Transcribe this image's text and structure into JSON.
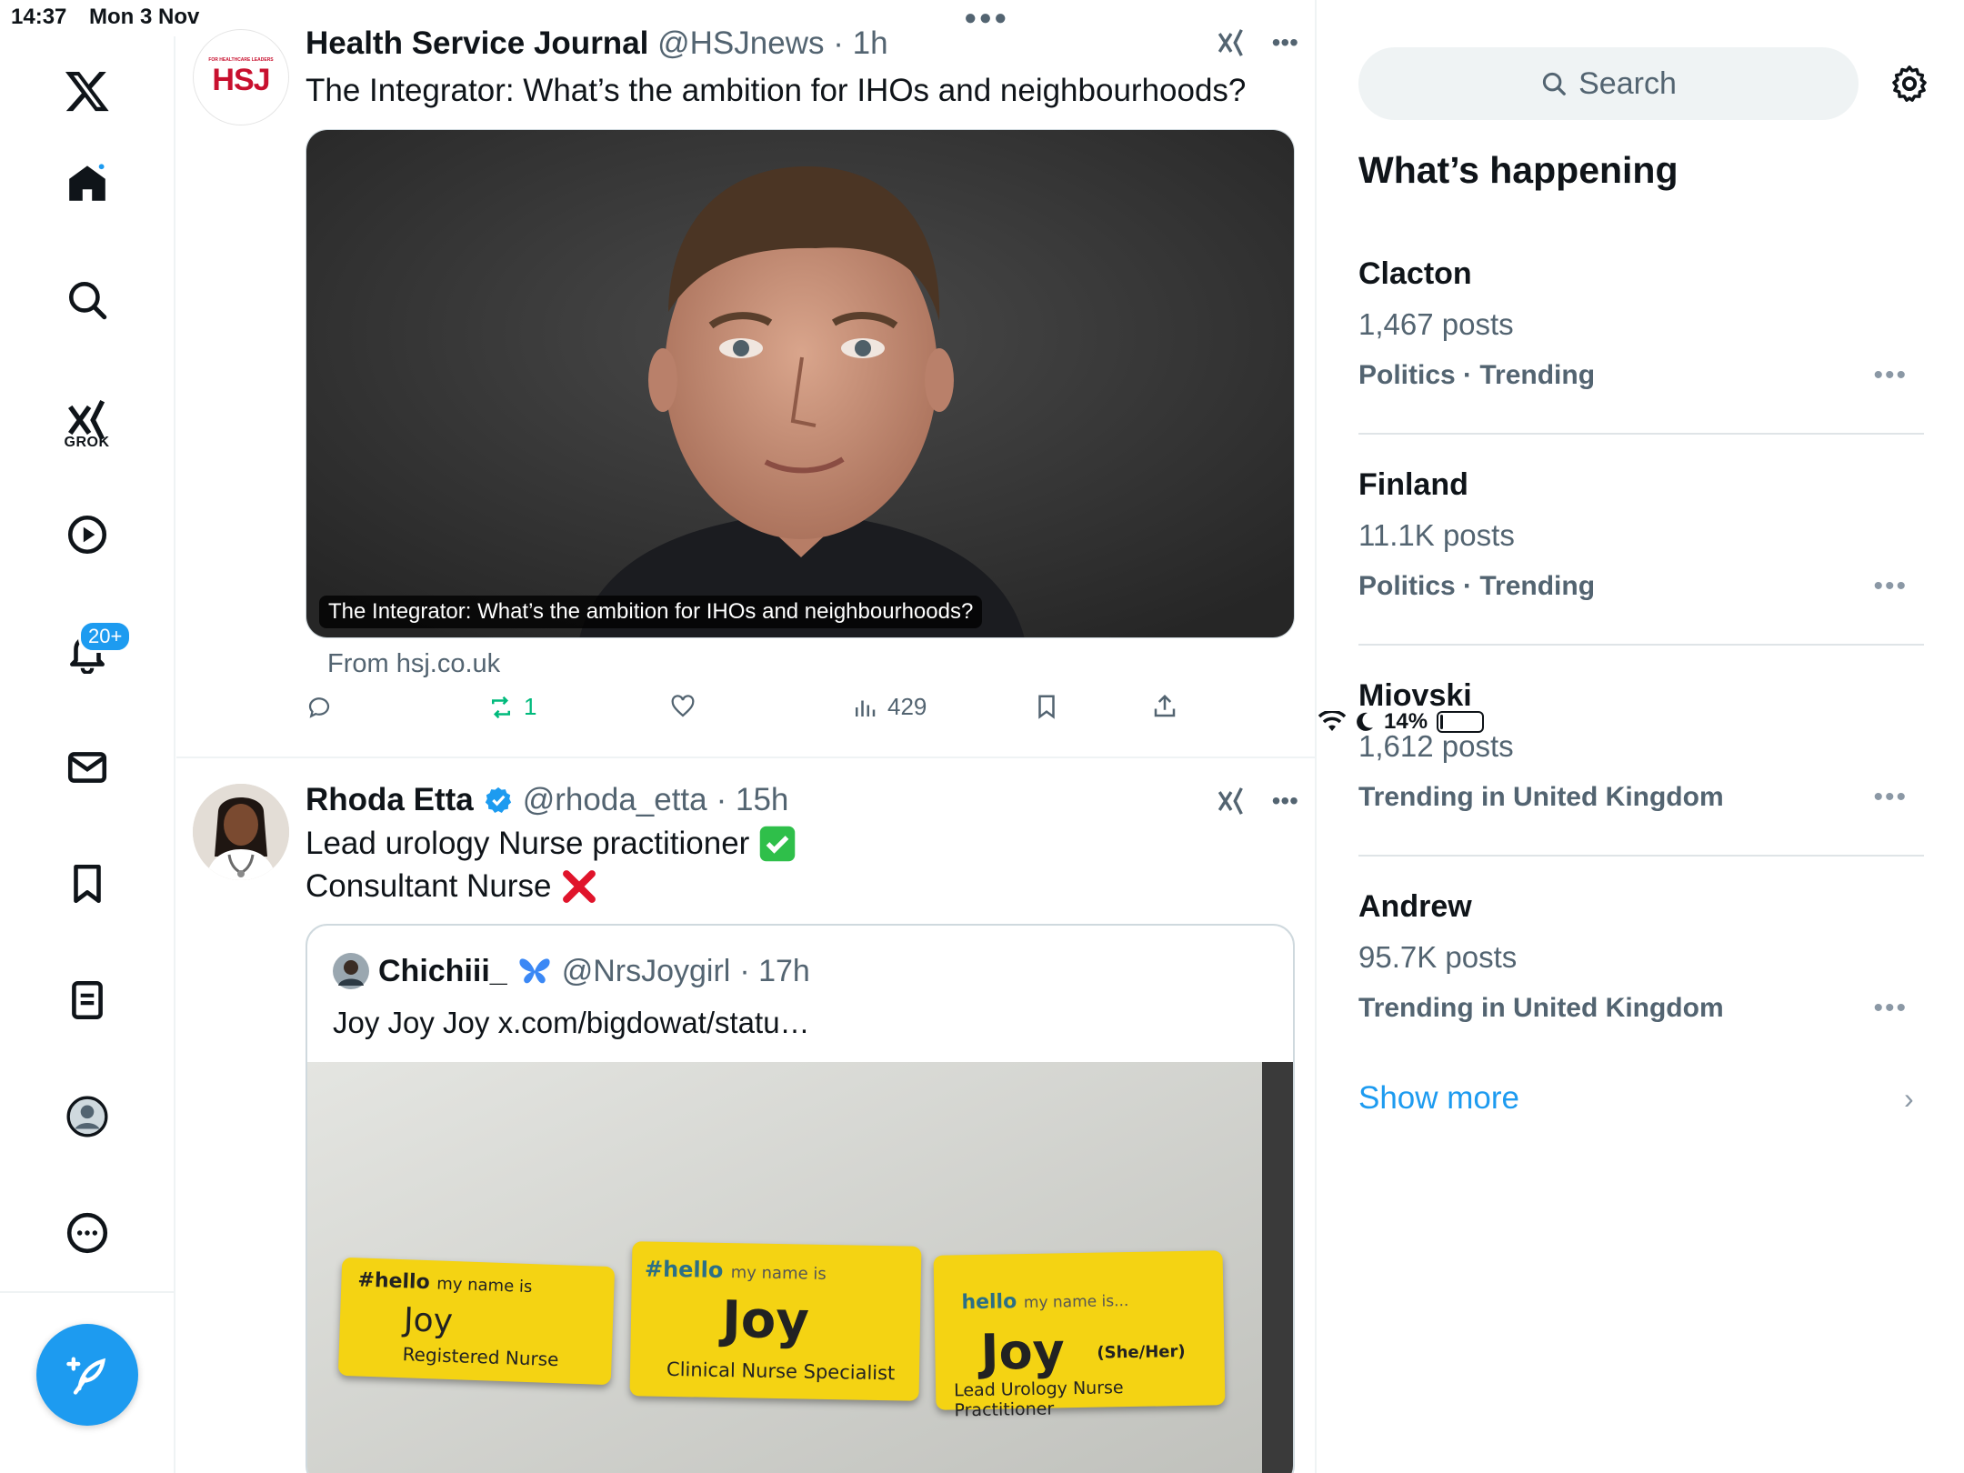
{
  "status": {
    "time": "14:37",
    "date": "Mon 3 Nov",
    "battery": "14%",
    "battery_level": 0.14
  },
  "nav": {
    "grok_label": "GROK",
    "notifications_badge": "20+"
  },
  "tweets": [
    {
      "name": "Health Service Journal",
      "handle": "@HSJnews",
      "time": "· 1h",
      "text": "The Integrator: What’s the ambition for IHOs and neighbourhoods?",
      "avatar_text": "HSJ",
      "avatar_small": "FOR HEALTHCARE LEADERS",
      "card_caption": "The Integrator: What’s the ambition for IHOs and neighbourhoods?",
      "card_from": "From hsj.co.uk",
      "stats": {
        "reposts": "1",
        "views": "429"
      }
    },
    {
      "name": "Rhoda Etta",
      "handle": "@rhoda_etta",
      "time": "· 15h",
      "text_line1": "Lead urology Nurse practitioner",
      "text_line2": "Consultant Nurse",
      "quote": {
        "name": "Chichiii_",
        "handle": "@NrsJoygirl",
        "time": "· 17h",
        "text": "Joy Joy Joy x.com/bigdowat/statu…",
        "badges": [
          {
            "hello": "#hello",
            "my_name": "my name is",
            "name": "Joy",
            "role": "Registered Nurse"
          },
          {
            "hello": "#hello",
            "my_name": "my name is",
            "name": "Joy",
            "role": "Clinical Nurse Specialist"
          },
          {
            "hello": "hello",
            "my_name": "my name is...",
            "name": "Joy",
            "pronoun": "(She/Her)",
            "role": "Lead Urology Nurse Practitioner"
          }
        ]
      }
    }
  ],
  "sidebar": {
    "search_placeholder": "Search",
    "title": "What’s happening",
    "trends": [
      {
        "title": "Clacton",
        "posts": "1,467 posts",
        "category": "Politics · Trending"
      },
      {
        "title": "Finland",
        "posts": "11.1K posts",
        "category": "Politics · Trending"
      },
      {
        "title": "Miovski",
        "posts": "1,612 posts",
        "category": "Trending in United Kingdom"
      },
      {
        "title": "Andrew",
        "posts": "95.7K posts",
        "category": "Trending in United Kingdom"
      }
    ],
    "show_more": "Show more"
  },
  "colors": {
    "accent": "#1d9bf0",
    "repost": "#00ba7c",
    "muted": "#536471"
  }
}
